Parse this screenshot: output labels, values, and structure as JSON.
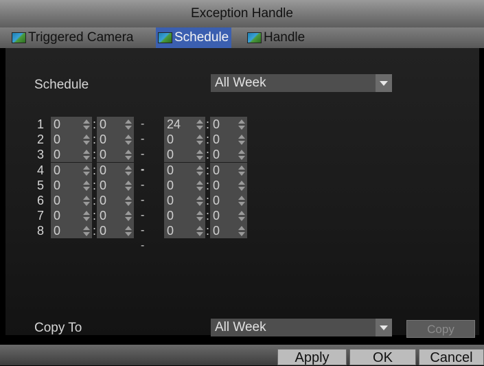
{
  "window": {
    "title": "Exception Handle"
  },
  "tabs": [
    {
      "label": "Triggered Camera",
      "icon": "camera-icon"
    },
    {
      "label": "Schedule",
      "icon": "camera-icon"
    },
    {
      "label": "Handle",
      "icon": "camera-icon"
    }
  ],
  "schedule": {
    "label": "Schedule",
    "value": "All Week"
  },
  "time_rows": [
    {
      "num": "1",
      "start_h": "0",
      "start_m": "0",
      "sep": "--",
      "end_h": "24",
      "end_m": "0"
    },
    {
      "num": "2",
      "start_h": "0",
      "start_m": "0",
      "sep": "--",
      "end_h": "0",
      "end_m": "0"
    },
    {
      "num": "3",
      "start_h": "0",
      "start_m": "0",
      "sep": "--",
      "end_h": "0",
      "end_m": "0"
    },
    {
      "num": "4",
      "start_h": "0",
      "start_m": "0",
      "sep": "--",
      "end_h": "0",
      "end_m": "0"
    },
    {
      "num": "5",
      "start_h": "0",
      "start_m": "0",
      "sep": "--",
      "end_h": "0",
      "end_m": "0"
    },
    {
      "num": "6",
      "start_h": "0",
      "start_m": "0",
      "sep": "--",
      "end_h": "0",
      "end_m": "0"
    },
    {
      "num": "7",
      "start_h": "0",
      "start_m": "0",
      "sep": "--",
      "end_h": "0",
      "end_m": "0"
    },
    {
      "num": "8",
      "start_h": "0",
      "start_m": "0",
      "sep": "--",
      "end_h": "0",
      "end_m": "0"
    }
  ],
  "colon": ":",
  "copy_to": {
    "label": "Copy To",
    "value": "All Week",
    "button": "Copy"
  },
  "footer": {
    "apply": "Apply",
    "ok": "OK",
    "cancel": "Cancel"
  },
  "colors": {
    "tab_active": "#3b5fb0",
    "background": "#1a1a1a"
  }
}
